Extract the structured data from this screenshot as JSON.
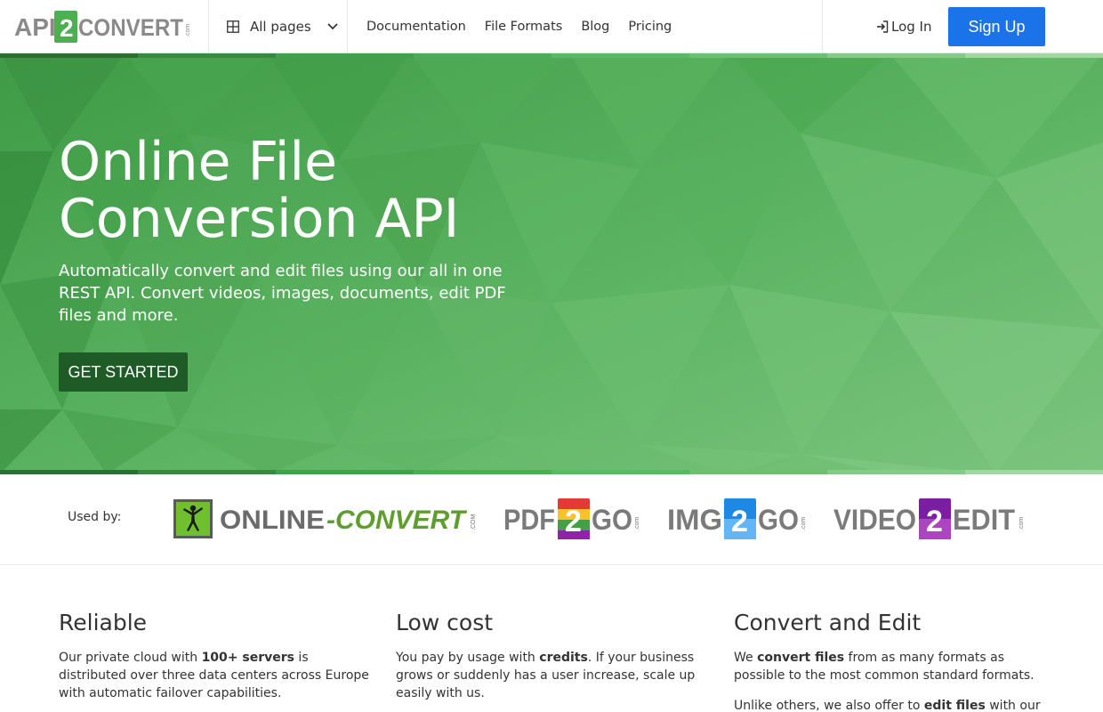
{
  "nav": {
    "logo": {
      "part1": "API",
      "digit": "2",
      "part2": "CONVERT",
      "suffix": ".com"
    },
    "all_pages": "All pages",
    "links": [
      "Documentation",
      "File Formats",
      "Blog",
      "Pricing"
    ],
    "login": "Log In",
    "signup": "Sign Up"
  },
  "hero": {
    "title_line1": "Online File",
    "title_line2": "Conversion API",
    "subtitle": "Automatically convert and edit files using our all in one REST API. Convert videos, images, documents, edit PDF files and more.",
    "cta": "GET STARTED"
  },
  "used_by": {
    "label": "Used by:",
    "brands": [
      {
        "name": "ONLINE-CONVERT",
        "part1": "ONLINE",
        "part2": "-CONVERT",
        "suffix": ".COM"
      },
      {
        "name": "PDF2GO",
        "part1": "PDF",
        "digit": "2",
        "part2": "GO",
        "suffix": ".com"
      },
      {
        "name": "IMG2GO",
        "part1": "IMG",
        "digit": "2",
        "part2": "GO",
        "suffix": ".com"
      },
      {
        "name": "VIDEO2EDIT",
        "part1": "VIDEO",
        "digit": "2",
        "part2": "EDIT",
        "suffix": ".com"
      }
    ]
  },
  "features": [
    {
      "title": "Reliable",
      "p1_before": "Our private cloud with ",
      "p1_bold": "100+ servers",
      "p1_after": " is distributed over three data centers across Europe with automatic failover capabilities."
    },
    {
      "title": "Low cost",
      "p1_before": "You pay by usage with ",
      "p1_bold": "credits",
      "p1_after": ". If your business grows or suddenly has a user increase, scale up easily with us."
    },
    {
      "title": "Convert and Edit",
      "p1_before": "We ",
      "p1_bold": "convert files",
      "p1_after": " from as many formats as possible to the most common standard formats.",
      "p2_before": "Unlike others, we also offer to ",
      "p2_bold": "edit files",
      "p2_after": " with our"
    }
  ],
  "colors": {
    "primary_blue": "#1a73e8",
    "hero_green": "#55ac5a",
    "cta_dark_green": "#1e5b26",
    "logo_green": "#4caf50"
  }
}
